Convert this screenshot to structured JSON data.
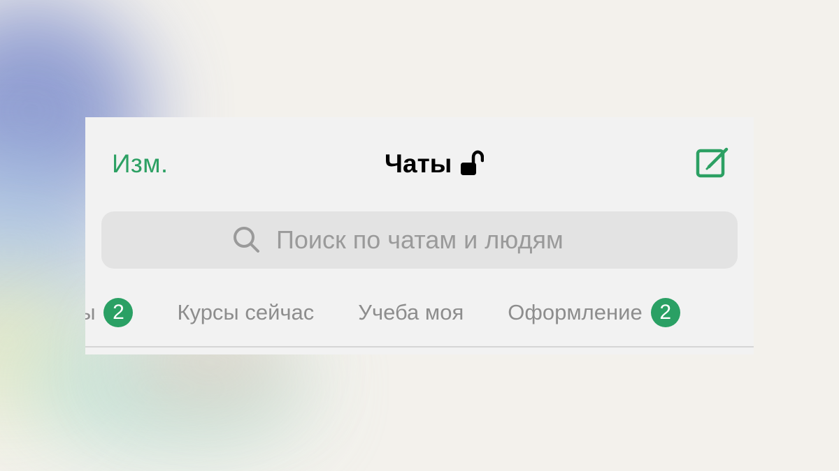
{
  "header": {
    "edit_label": "Изм.",
    "title": "Чаты",
    "lock_icon": "open-lock-icon",
    "compose_icon": "compose-icon"
  },
  "search": {
    "placeholder": "Поиск по чатам и людям",
    "icon": "search-icon"
  },
  "tabs": [
    {
      "label": "ты",
      "badge": "2"
    },
    {
      "label": "Курсы сейчас"
    },
    {
      "label": "Учеба моя"
    },
    {
      "label": "Оформление",
      "badge": "2"
    }
  ],
  "colors": {
    "accent": "#2ca063",
    "badge": "#2aa064",
    "panel": "#f2f2f2",
    "search_field": "#e3e3e3"
  }
}
